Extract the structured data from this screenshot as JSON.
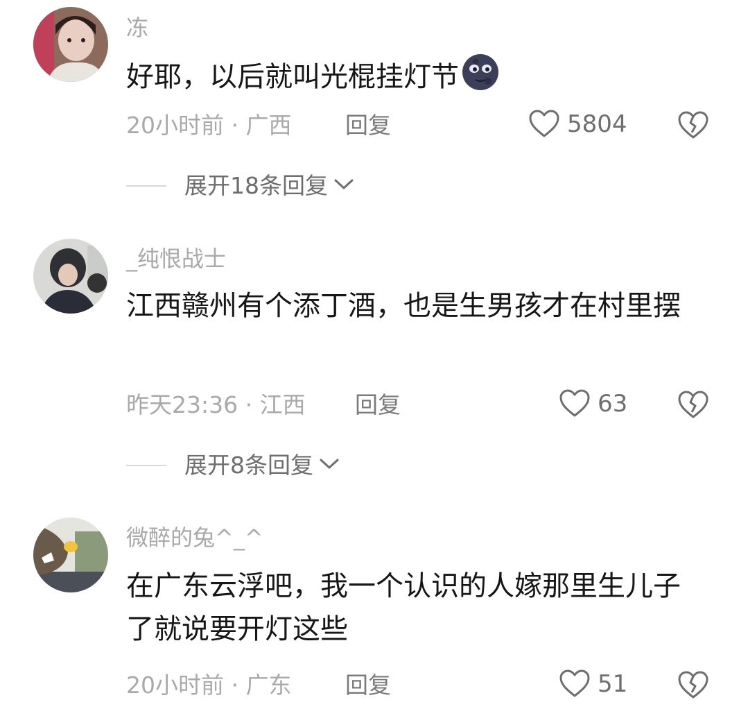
{
  "comments": [
    {
      "username": "冻",
      "text": "好耶，以后就叫光棍挂灯节",
      "emoji": "new-moon-face",
      "time_location": "20小时前 · 广西",
      "reply_label": "回复",
      "likes": "5804",
      "expand_label": "展开18条回复"
    },
    {
      "username": "_纯恨战士",
      "text": "江西赣州有个添丁酒，也是生男孩才在村里摆",
      "time_location": "昨天23:36 · 江西",
      "reply_label": "回复",
      "likes": "63",
      "expand_label": "展开8条回复"
    },
    {
      "username": "微醉的兔^_^",
      "text": "在广东云浮吧，我一个认识的人嫁那里生儿子了就说要开灯这些",
      "time_location": "20小时前 · 广东",
      "reply_label": "回复",
      "likes": "51"
    }
  ],
  "colors": {
    "username": "#a9a9a9",
    "body_text": "#161616",
    "meta": "#a9a9a9",
    "icon": "#6e6e6e"
  },
  "icons": [
    "heart-icon",
    "broken-heart-icon",
    "chevron-down-icon",
    "new-moon-face-emoji"
  ]
}
